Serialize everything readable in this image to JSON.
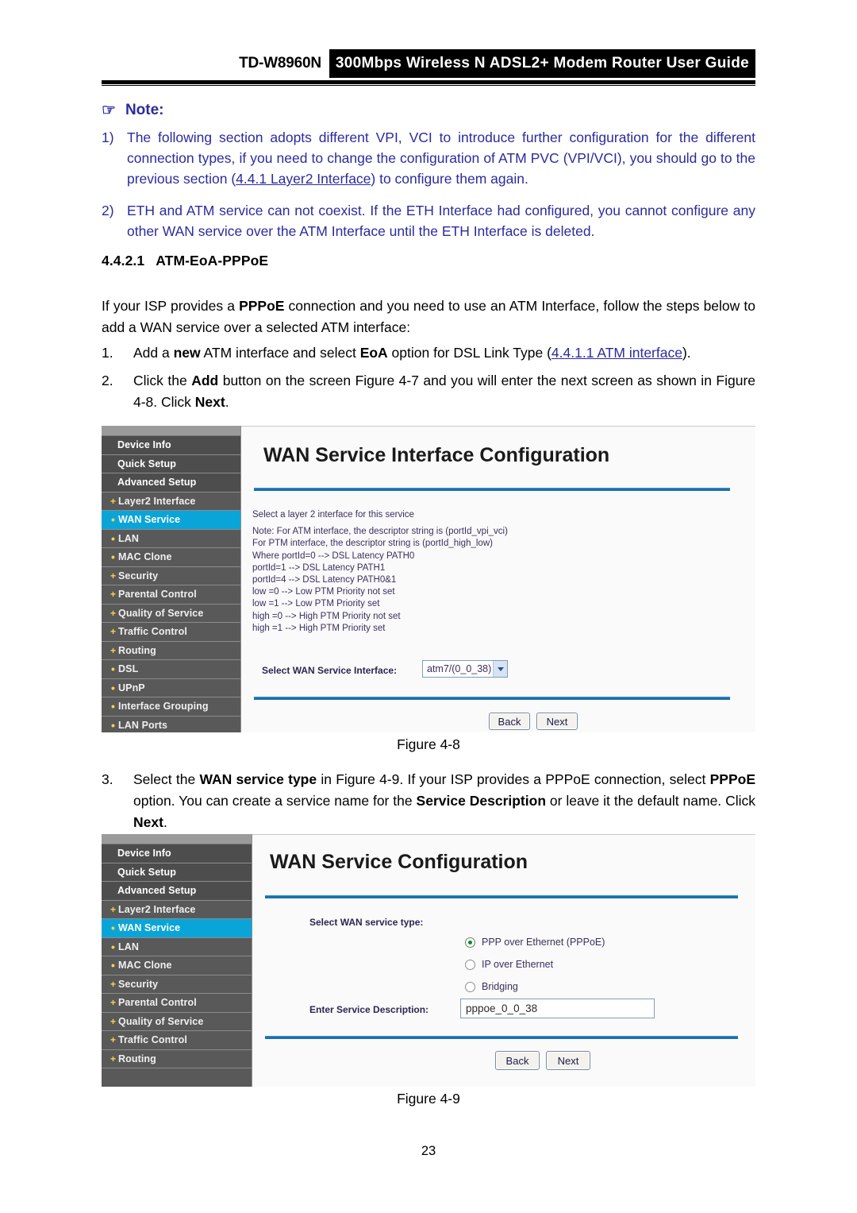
{
  "header": {
    "model": "TD-W8960N",
    "band_title": "300Mbps Wireless N ADSL2+ Modem Router User Guide"
  },
  "note": {
    "icon": "pointing-hand-icon",
    "hand_glyph": "☞",
    "title": "Note:",
    "items": [
      {
        "num": "1)",
        "text_before": "The following section adopts different VPI, VCI to introduce further configuration for the different connection types, if you need to change the configuration of ATM PVC (VPI/VCI), you should go to the previous section (",
        "link": "4.4.1 Layer2 Interface",
        "text_after": ") to configure them again."
      },
      {
        "num": "2)",
        "text_before": "ETH and ATM service can not coexist. If the ETH Interface had configured, you cannot configure any other WAN service over the ATM Interface until the ETH Interface is deleted.",
        "link": "",
        "text_after": ""
      }
    ]
  },
  "section": {
    "number": "4.4.2.1",
    "title": "ATM-EoA-PPPoE"
  },
  "intro": {
    "part1": "If your ISP provides a ",
    "bold1": "PPPoE",
    "part2": " connection and you need to use an ATM Interface, follow the steps below to add a WAN service over a selected ATM interface:"
  },
  "steps": {
    "step1": {
      "num": "1.",
      "part1": "Add a ",
      "bold1": "new",
      "part2": " ATM interface and select ",
      "bold2": "EoA",
      "part3": " option for DSL Link Type (",
      "link": "4.4.1.1 ATM interface",
      "part4": ")."
    },
    "step2": {
      "num": "2.",
      "part1": "Click the ",
      "bold1": "Add",
      "part2": " button on the screen Figure 4-7 and you will enter the next screen as shown in Figure 4-8. Click ",
      "bold2": "Next",
      "part3": "."
    },
    "step3": {
      "num": "3.",
      "part1": "Select the ",
      "bold1": "WAN service type",
      "part2": " in Figure 4-9. If your ISP provides a PPPoE connection, select ",
      "bold2": "PPPoE",
      "part3": " option. You can create a service name for the ",
      "bold3": "Service Description",
      "part4": " or leave it the default name. Click ",
      "bold4": "Next",
      "part5": "."
    }
  },
  "figure_48": {
    "caption": "Figure 4-8",
    "sidebar": [
      {
        "label": "Device Info",
        "marker": "",
        "level": "top",
        "active": false
      },
      {
        "label": "Quick Setup",
        "marker": "",
        "level": "top",
        "active": false
      },
      {
        "label": "Advanced Setup",
        "marker": "",
        "level": "top",
        "active": false
      },
      {
        "label": "Layer2 Interface",
        "marker": "+",
        "level": "child",
        "active": false
      },
      {
        "label": "WAN Service",
        "marker": "•",
        "level": "child",
        "active": true
      },
      {
        "label": "LAN",
        "marker": "•",
        "level": "child",
        "active": false
      },
      {
        "label": "MAC Clone",
        "marker": "•",
        "level": "child",
        "active": false
      },
      {
        "label": "Security",
        "marker": "+",
        "level": "child",
        "active": false
      },
      {
        "label": "Parental Control",
        "marker": "+",
        "level": "child",
        "active": false
      },
      {
        "label": "Quality of Service",
        "marker": "+",
        "level": "child",
        "active": false
      },
      {
        "label": "Traffic Control",
        "marker": "+",
        "level": "child",
        "active": false
      },
      {
        "label": "Routing",
        "marker": "+",
        "level": "child",
        "active": false
      },
      {
        "label": "DSL",
        "marker": "•",
        "level": "child",
        "active": false
      },
      {
        "label": "UPnP",
        "marker": "•",
        "level": "child",
        "active": false
      },
      {
        "label": "Interface Grouping",
        "marker": "•",
        "level": "child",
        "active": false
      },
      {
        "label": "LAN Ports",
        "marker": "•",
        "level": "child",
        "active": false
      }
    ],
    "panel_title": "WAN Service Interface Configuration",
    "desc_lines": [
      "Select a layer 2 interface for this service",
      "Note: For ATM interface, the descriptor string is (portId_vpi_vci)",
      "For PTM interface, the descriptor string is (portId_high_low)",
      "Where portId=0 --> DSL Latency PATH0",
      "portId=1 --> DSL Latency PATH1",
      "portId=4 --> DSL Latency PATH0&1",
      "low =0 --> Low PTM Priority not set",
      "low =1 --> Low PTM Priority set",
      "high =0 --> High PTM Priority not set",
      "high =1 --> High PTM Priority set"
    ],
    "select_label": "Select WAN Service Interface:",
    "select_value": "atm7/(0_0_38)",
    "back_label": "Back",
    "next_label": "Next"
  },
  "figure_49": {
    "caption": "Figure 4-9",
    "sidebar": [
      {
        "label": "Device Info",
        "marker": "",
        "level": "top",
        "active": false
      },
      {
        "label": "Quick Setup",
        "marker": "",
        "level": "top",
        "active": false
      },
      {
        "label": "Advanced Setup",
        "marker": "",
        "level": "top",
        "active": false
      },
      {
        "label": "Layer2 Interface",
        "marker": "+",
        "level": "child",
        "active": false
      },
      {
        "label": "WAN Service",
        "marker": "•",
        "level": "child",
        "active": true
      },
      {
        "label": "LAN",
        "marker": "•",
        "level": "child",
        "active": false
      },
      {
        "label": "MAC Clone",
        "marker": "•",
        "level": "child",
        "active": false
      },
      {
        "label": "Security",
        "marker": "+",
        "level": "child",
        "active": false
      },
      {
        "label": "Parental Control",
        "marker": "+",
        "level": "child",
        "active": false
      },
      {
        "label": "Quality of Service",
        "marker": "+",
        "level": "child",
        "active": false
      },
      {
        "label": "Traffic Control",
        "marker": "+",
        "level": "child",
        "active": false
      },
      {
        "label": "Routing",
        "marker": "+",
        "level": "child",
        "active": false
      }
    ],
    "panel_title": "WAN Service Configuration",
    "service_type_label": "Select WAN service type:",
    "radios": [
      {
        "label": "PPP over Ethernet (PPPoE)",
        "checked": true
      },
      {
        "label": "IP over Ethernet",
        "checked": false
      },
      {
        "label": "Bridging",
        "checked": false
      }
    ],
    "description_label": "Enter Service Description:",
    "description_value": "pppoe_0_0_38",
    "back_label": "Back",
    "next_label": "Next"
  },
  "footer": {
    "page_number": "23"
  },
  "colors": {
    "link": "#2b2b9e",
    "note": "#2b2b9e",
    "sidebar_active": "#0aa5d8",
    "sidebar_bg": "#595959",
    "panel_rule": "#1a6fae",
    "bullet": "#ffd24a"
  }
}
